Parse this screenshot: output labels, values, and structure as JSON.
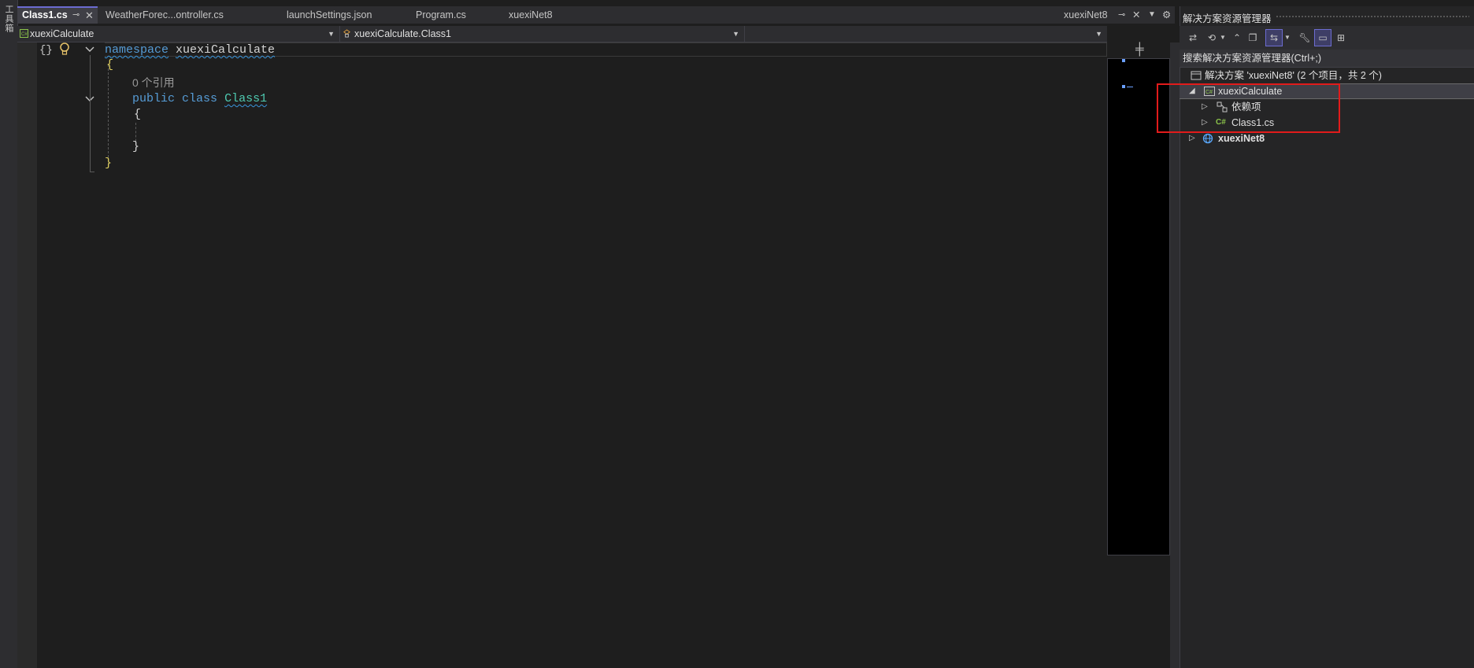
{
  "toolbox": {
    "label": "工具箱"
  },
  "tabs": [
    {
      "label": "Class1.cs",
      "active": true
    },
    {
      "label": "WeatherForec...ontroller.cs"
    },
    {
      "label": "launchSettings.json"
    },
    {
      "label": "Program.cs"
    },
    {
      "label": "xuexiNet8"
    }
  ],
  "right_tab": {
    "label": "xuexiNet8"
  },
  "navbar": {
    "project": "xuexiCalculate",
    "type": "xuexiCalculate.Class1",
    "member": ""
  },
  "code": {
    "line1_keyword": "namespace",
    "line1_name": "xuexiCalculate",
    "open_brace": "{",
    "references": "0 个引用",
    "line3_public": "public",
    "line3_class": "class",
    "line3_name": "Class1",
    "inner_open": "{",
    "inner_close": "}",
    "close_brace": "}"
  },
  "solution_explorer": {
    "title": "解决方案资源管理器",
    "search_placeholder": "搜索解决方案资源管理器(Ctrl+;)",
    "solution": "解决方案 'xuexiNet8' (2 个项目，共 2 个)",
    "project1": "xuexiCalculate",
    "dependencies": "依赖项",
    "file": "Class1.cs",
    "project2": "xuexiNet8"
  },
  "colors": {
    "accent": "#6c6cd1",
    "highlight_box": "#e21b1b",
    "keyword": "#569cd6",
    "type": "#4ec9b0"
  }
}
